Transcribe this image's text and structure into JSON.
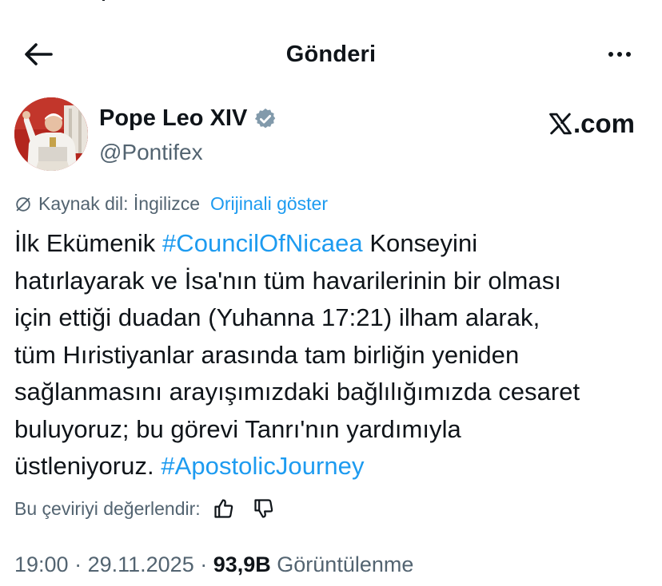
{
  "header": {
    "title": "Gönderi"
  },
  "author": {
    "display_name": "Pope Leo XIV",
    "handle": "@Pontifex",
    "watermark": ".com"
  },
  "translation": {
    "source_label": "Kaynak dil: İngilizce",
    "show_original": "Orijinali göster"
  },
  "tweet": {
    "lines": [
      {
        "segments": [
          {
            "text": "İlk Ekümenik ",
            "hashtag": false
          },
          {
            "text": "#CouncilOfNicaea",
            "hashtag": true
          },
          {
            "text": " Konseyini",
            "hashtag": false
          }
        ]
      },
      {
        "segments": [
          {
            "text": "hatırlayarak ve İsa'nın tüm havarilerinin bir olması",
            "hashtag": false
          }
        ]
      },
      {
        "segments": [
          {
            "text": "için ettiği duadan (Yuhanna 17:21) ilham alarak,",
            "hashtag": false
          }
        ]
      },
      {
        "segments": [
          {
            "text": "tüm Hıristiyanlar arasında tam birliğin yeniden",
            "hashtag": false
          }
        ]
      },
      {
        "segments": [
          {
            "text": "sağlanmasını arayışımızdaki bağlılığımızda cesaret",
            "hashtag": false
          }
        ]
      },
      {
        "segments": [
          {
            "text": "buluyoruz; bu görevi Tanrı'nın yardımıyla",
            "hashtag": false
          }
        ]
      },
      {
        "segments": [
          {
            "text": "üstleniyoruz. ",
            "hashtag": false
          },
          {
            "text": "#ApostolicJourney",
            "hashtag": true
          }
        ]
      }
    ]
  },
  "rate": {
    "label": "Bu çeviriyi değerlendir:"
  },
  "meta": {
    "time": "19:00",
    "separator": " · ",
    "date": "29.11.2025",
    "views_count": "93,9B",
    "views_label": " Görüntülenme"
  },
  "colors": {
    "accent": "#1d9bf0",
    "text": "#0f1419",
    "secondary": "#536471"
  },
  "icons": {
    "back": "arrow-left-icon",
    "more": "more-horizontal-icon",
    "verified": "verified-badge-icon",
    "x_logo": "x-logo-icon",
    "translation": "globe-slash-icon",
    "thumbs_up": "thumbs-up-icon",
    "thumbs_down": "thumbs-down-icon"
  }
}
